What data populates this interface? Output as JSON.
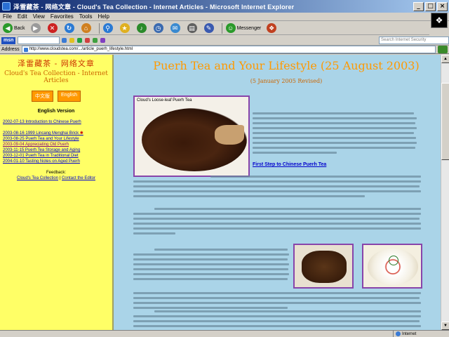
{
  "window": {
    "title": "泽雷藏茶 - 网络文章 - Cloud's Tea Collection - Internet Articles - Microsoft Internet Explorer"
  },
  "menu": [
    "File",
    "Edit",
    "View",
    "Favorites",
    "Tools",
    "Help"
  ],
  "toolbar": [
    {
      "name": "back-button",
      "icon": "back-arrow-icon",
      "label": "Back",
      "color": "#2a9a2a"
    },
    {
      "name": "forward-button",
      "icon": "forward-arrow-icon",
      "label": "",
      "color": "#9a9a9a"
    },
    {
      "name": "stop-button",
      "icon": "stop-icon",
      "label": "",
      "color": "#cc2222"
    },
    {
      "name": "refresh-button",
      "icon": "refresh-icon",
      "label": "",
      "color": "#2a7ad4"
    },
    {
      "name": "home-button",
      "icon": "home-icon",
      "label": "",
      "color": "#d08020"
    },
    {
      "name": "search-button",
      "icon": "search-icon",
      "label": "",
      "color": "#2a7ad4"
    },
    {
      "name": "favorites-button",
      "icon": "star-icon",
      "label": "",
      "color": "#e0b020"
    },
    {
      "name": "media-button",
      "icon": "media-icon",
      "label": "",
      "color": "#2a8a2a"
    },
    {
      "name": "history-button",
      "icon": "history-icon",
      "label": "",
      "color": "#3a6ab0"
    },
    {
      "name": "mail-button",
      "icon": "mail-icon",
      "label": "",
      "color": "#3a8ad0"
    },
    {
      "name": "print-button",
      "icon": "print-icon",
      "label": "",
      "color": "#606060"
    },
    {
      "name": "edit-button",
      "icon": "edit-icon",
      "label": "",
      "color": "#3a5ab0"
    },
    {
      "name": "messenger-button",
      "icon": "messenger-icon",
      "label": "Messenger",
      "color": "#2a9a2a"
    },
    {
      "name": "research-button",
      "icon": "research-icon",
      "label": "",
      "color": "#c04020"
    }
  ],
  "searchbar": {
    "logo": "msn",
    "input_value": "",
    "items": [
      "",
      "",
      "",
      "",
      "",
      ""
    ],
    "right_text": "Search Internet Security"
  },
  "address": {
    "label": "Address",
    "url": "http://www.cloudstea.com/.../article_puerh_lifestyle.html"
  },
  "sidebar": {
    "title_cn": "泽雷藏茶 - 网络文章",
    "title_en": "Cloud's Tea Collection - Internet Articles",
    "buttons": [
      "中文版",
      "English"
    ],
    "heading": "English Version",
    "links": [
      {
        "text": "2002-07-13 Introduction to Chinese Puerh",
        "visited": false,
        "spaced": true
      },
      {
        "text": "2003-08-16 1999 Lincang Menghai Brick",
        "visited": false,
        "new": true,
        "spaced": false
      },
      {
        "text": "2003-08-25 Puerh Tea and Your Lifestyle",
        "visited": false,
        "spaced": false
      },
      {
        "text": "2003-09-04 Appreciating Old Puerh",
        "visited": true,
        "spaced": false
      },
      {
        "text": "2003-11-15 Puerh Tea Storage and Aging",
        "visited": false,
        "spaced": false
      },
      {
        "text": "2003-12-01 Puerh Tea in Traditional Diet",
        "visited": false,
        "spaced": false
      },
      {
        "text": "2004-01-10 Tasting Notes on Aged Puerh",
        "visited": false,
        "spaced": false
      }
    ],
    "footer_label": "Feedback:",
    "footer_links": [
      "Cloud's Tea Collection",
      "Contact the Editor"
    ]
  },
  "main": {
    "title": "Puerh Tea and Your Lifestyle (25 August 2003)",
    "revised": "(5 January 2005 Revised)",
    "photo1_caption": "Cloud's Loose-leaf Puerh Tea",
    "intro_link": "First Step to Chinese Puerh Tea"
  },
  "status": {
    "text": "",
    "zone": "Internet"
  }
}
